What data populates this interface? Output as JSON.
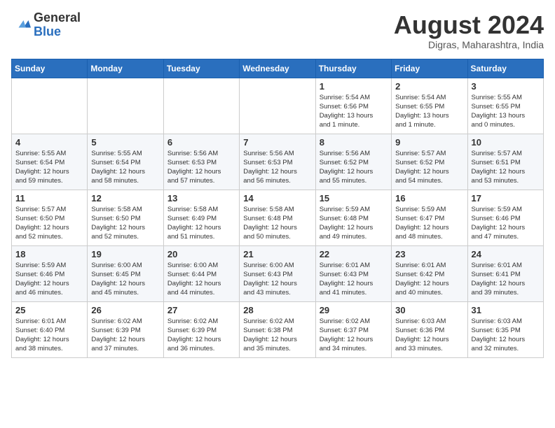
{
  "header": {
    "logo_general": "General",
    "logo_blue": "Blue",
    "month_title": "August 2024",
    "subtitle": "Digras, Maharashtra, India"
  },
  "calendar": {
    "days_of_week": [
      "Sunday",
      "Monday",
      "Tuesday",
      "Wednesday",
      "Thursday",
      "Friday",
      "Saturday"
    ],
    "weeks": [
      [
        {
          "day": "",
          "info": ""
        },
        {
          "day": "",
          "info": ""
        },
        {
          "day": "",
          "info": ""
        },
        {
          "day": "",
          "info": ""
        },
        {
          "day": "1",
          "info": "Sunrise: 5:54 AM\nSunset: 6:56 PM\nDaylight: 13 hours\nand 1 minute."
        },
        {
          "day": "2",
          "info": "Sunrise: 5:54 AM\nSunset: 6:55 PM\nDaylight: 13 hours\nand 1 minute."
        },
        {
          "day": "3",
          "info": "Sunrise: 5:55 AM\nSunset: 6:55 PM\nDaylight: 13 hours\nand 0 minutes."
        }
      ],
      [
        {
          "day": "4",
          "info": "Sunrise: 5:55 AM\nSunset: 6:54 PM\nDaylight: 12 hours\nand 59 minutes."
        },
        {
          "day": "5",
          "info": "Sunrise: 5:55 AM\nSunset: 6:54 PM\nDaylight: 12 hours\nand 58 minutes."
        },
        {
          "day": "6",
          "info": "Sunrise: 5:56 AM\nSunset: 6:53 PM\nDaylight: 12 hours\nand 57 minutes."
        },
        {
          "day": "7",
          "info": "Sunrise: 5:56 AM\nSunset: 6:53 PM\nDaylight: 12 hours\nand 56 minutes."
        },
        {
          "day": "8",
          "info": "Sunrise: 5:56 AM\nSunset: 6:52 PM\nDaylight: 12 hours\nand 55 minutes."
        },
        {
          "day": "9",
          "info": "Sunrise: 5:57 AM\nSunset: 6:52 PM\nDaylight: 12 hours\nand 54 minutes."
        },
        {
          "day": "10",
          "info": "Sunrise: 5:57 AM\nSunset: 6:51 PM\nDaylight: 12 hours\nand 53 minutes."
        }
      ],
      [
        {
          "day": "11",
          "info": "Sunrise: 5:57 AM\nSunset: 6:50 PM\nDaylight: 12 hours\nand 52 minutes."
        },
        {
          "day": "12",
          "info": "Sunrise: 5:58 AM\nSunset: 6:50 PM\nDaylight: 12 hours\nand 52 minutes."
        },
        {
          "day": "13",
          "info": "Sunrise: 5:58 AM\nSunset: 6:49 PM\nDaylight: 12 hours\nand 51 minutes."
        },
        {
          "day": "14",
          "info": "Sunrise: 5:58 AM\nSunset: 6:48 PM\nDaylight: 12 hours\nand 50 minutes."
        },
        {
          "day": "15",
          "info": "Sunrise: 5:59 AM\nSunset: 6:48 PM\nDaylight: 12 hours\nand 49 minutes."
        },
        {
          "day": "16",
          "info": "Sunrise: 5:59 AM\nSunset: 6:47 PM\nDaylight: 12 hours\nand 48 minutes."
        },
        {
          "day": "17",
          "info": "Sunrise: 5:59 AM\nSunset: 6:46 PM\nDaylight: 12 hours\nand 47 minutes."
        }
      ],
      [
        {
          "day": "18",
          "info": "Sunrise: 5:59 AM\nSunset: 6:46 PM\nDaylight: 12 hours\nand 46 minutes."
        },
        {
          "day": "19",
          "info": "Sunrise: 6:00 AM\nSunset: 6:45 PM\nDaylight: 12 hours\nand 45 minutes."
        },
        {
          "day": "20",
          "info": "Sunrise: 6:00 AM\nSunset: 6:44 PM\nDaylight: 12 hours\nand 44 minutes."
        },
        {
          "day": "21",
          "info": "Sunrise: 6:00 AM\nSunset: 6:43 PM\nDaylight: 12 hours\nand 43 minutes."
        },
        {
          "day": "22",
          "info": "Sunrise: 6:01 AM\nSunset: 6:43 PM\nDaylight: 12 hours\nand 41 minutes."
        },
        {
          "day": "23",
          "info": "Sunrise: 6:01 AM\nSunset: 6:42 PM\nDaylight: 12 hours\nand 40 minutes."
        },
        {
          "day": "24",
          "info": "Sunrise: 6:01 AM\nSunset: 6:41 PM\nDaylight: 12 hours\nand 39 minutes."
        }
      ],
      [
        {
          "day": "25",
          "info": "Sunrise: 6:01 AM\nSunset: 6:40 PM\nDaylight: 12 hours\nand 38 minutes."
        },
        {
          "day": "26",
          "info": "Sunrise: 6:02 AM\nSunset: 6:39 PM\nDaylight: 12 hours\nand 37 minutes."
        },
        {
          "day": "27",
          "info": "Sunrise: 6:02 AM\nSunset: 6:39 PM\nDaylight: 12 hours\nand 36 minutes."
        },
        {
          "day": "28",
          "info": "Sunrise: 6:02 AM\nSunset: 6:38 PM\nDaylight: 12 hours\nand 35 minutes."
        },
        {
          "day": "29",
          "info": "Sunrise: 6:02 AM\nSunset: 6:37 PM\nDaylight: 12 hours\nand 34 minutes."
        },
        {
          "day": "30",
          "info": "Sunrise: 6:03 AM\nSunset: 6:36 PM\nDaylight: 12 hours\nand 33 minutes."
        },
        {
          "day": "31",
          "info": "Sunrise: 6:03 AM\nSunset: 6:35 PM\nDaylight: 12 hours\nand 32 minutes."
        }
      ]
    ]
  }
}
